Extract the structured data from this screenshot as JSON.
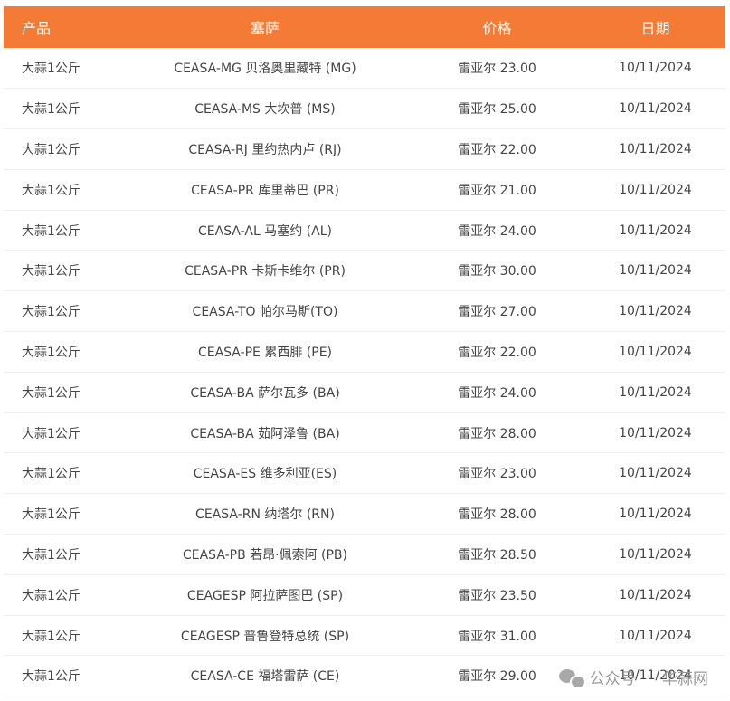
{
  "table": {
    "headers": [
      "产品",
      "塞萨",
      "价格",
      "日期"
    ],
    "rows": [
      [
        "大蒜1公斤",
        "CEASA-MG 贝洛奥里藏特 (MG)",
        "雷亚尔 23.00",
        "10/11/2024"
      ],
      [
        "大蒜1公斤",
        "CEASA-MS 大坎普 (MS)",
        "雷亚尔 25.00",
        "10/11/2024"
      ],
      [
        "大蒜1公斤",
        "CEASA-RJ 里约热内卢 (RJ)",
        "雷亚尔 22.00",
        "10/11/2024"
      ],
      [
        "大蒜1公斤",
        "CEASA-PR 库里蒂巴 (PR)",
        "雷亚尔 21.00",
        "10/11/2024"
      ],
      [
        "大蒜1公斤",
        "CEASA-AL 马塞约 (AL)",
        "雷亚尔 24.00",
        "10/11/2024"
      ],
      [
        "大蒜1公斤",
        "CEASA-PR 卡斯卡维尔 (PR)",
        "雷亚尔 30.00",
        "10/11/2024"
      ],
      [
        "大蒜1公斤",
        "CEASA-TO 帕尔马斯(TO)",
        "雷亚尔 27.00",
        "10/11/2024"
      ],
      [
        "大蒜1公斤",
        "CEASA-PE 累西腓 (PE)",
        "雷亚尔 22.00",
        "10/11/2024"
      ],
      [
        "大蒜1公斤",
        "CEASA-BA 萨尔瓦多 (BA)",
        "雷亚尔 24.00",
        "10/11/2024"
      ],
      [
        "大蒜1公斤",
        "CEASA-BA 茹阿泽鲁 (BA)",
        "雷亚尔 28.00",
        "10/11/2024"
      ],
      [
        "大蒜1公斤",
        "CEASA-ES 维多利亚(ES)",
        "雷亚尔 23.00",
        "10/11/2024"
      ],
      [
        "大蒜1公斤",
        "CEASA-RN 纳塔尔 (RN)",
        "雷亚尔 28.00",
        "10/11/2024"
      ],
      [
        "大蒜1公斤",
        "CEASA-PB 若昂·佩索阿 (PB)",
        "雷亚尔 28.50",
        "10/11/2024"
      ],
      [
        "大蒜1公斤",
        "CEAGESP 阿拉萨图巴 (SP)",
        "雷亚尔 23.50",
        "10/11/2024"
      ],
      [
        "大蒜1公斤",
        "CEAGESP 普鲁登特总统 (SP)",
        "雷亚尔 31.00",
        "10/11/2024"
      ],
      [
        "大蒜1公斤",
        "CEASA-CE 福塔雷萨 (CE)",
        "雷亚尔 29.00",
        "10/11/2024"
      ]
    ]
  },
  "watermark": {
    "icon": "wechat-icon",
    "account_label": "公众号",
    "name": "华蒜网"
  },
  "colors": {
    "header_bg": "#F47B35",
    "header_text": "#ffffff",
    "row_border": "#eeeeee"
  }
}
